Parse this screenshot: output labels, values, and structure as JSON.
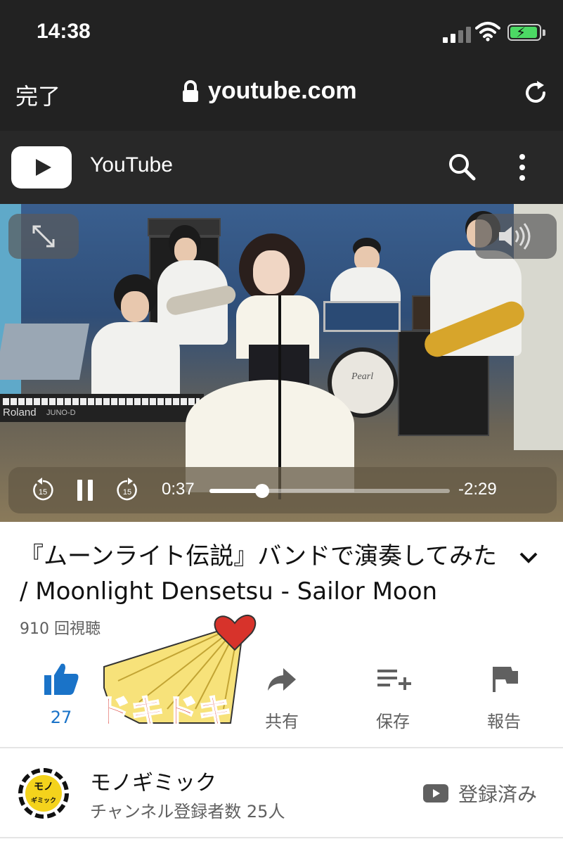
{
  "status_bar": {
    "time": "14:38"
  },
  "browser": {
    "done_label": "完了",
    "url": "youtube.com"
  },
  "yt_header": {
    "title": "YouTube"
  },
  "player": {
    "current_time": "0:37",
    "remaining_time": "-2:29",
    "progress": 0.22,
    "skip_back": "15",
    "skip_forward": "15"
  },
  "video": {
    "title": "『ムーンライト伝説』バンドで演奏してみた / Moonlight Densetsu - Sailor Moon",
    "views": "910 回視聴",
    "keyboard_brand": "Roland",
    "keyboard_model": "JUNO-D",
    "drum_brand": "Pearl"
  },
  "actions": {
    "like_count": "27",
    "share_label": "共有",
    "save_label": "保存",
    "report_label": "報告"
  },
  "sticker": {
    "text": "ドキドキ"
  },
  "channel": {
    "name": "モノギミック",
    "subscribers": "チャンネル登録者数 25人",
    "subscribed_label": "登録済み",
    "avatar_text_1": "モノ",
    "avatar_text_2": "ギミック"
  },
  "colors": {
    "accent_blue": "#1a73c8",
    "dark_bar": "#222222",
    "yt_header": "#282828",
    "battery_green": "#4cd964",
    "sticker_red": "#d7332b",
    "sticker_yellow": "#f7e27a"
  }
}
